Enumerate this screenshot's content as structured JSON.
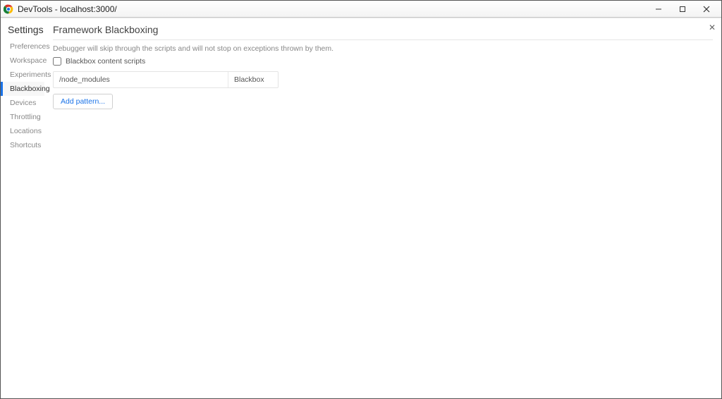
{
  "window": {
    "title": "DevTools - localhost:3000/"
  },
  "settings_header": "Settings",
  "sidebar": {
    "items": [
      {
        "label": "Preferences"
      },
      {
        "label": "Workspace"
      },
      {
        "label": "Experiments"
      },
      {
        "label": "Blackboxing"
      },
      {
        "label": "Devices"
      },
      {
        "label": "Throttling"
      },
      {
        "label": "Locations"
      },
      {
        "label": "Shortcuts"
      }
    ],
    "active_index": 3
  },
  "main": {
    "title": "Framework Blackboxing",
    "description": "Debugger will skip through the scripts and will not stop on exceptions thrown by them.",
    "checkbox_label": "Blackbox content scripts",
    "checkbox_checked": false,
    "patterns": [
      {
        "pattern": "/node_modules",
        "behavior": "Blackbox"
      }
    ],
    "add_button": "Add pattern..."
  }
}
